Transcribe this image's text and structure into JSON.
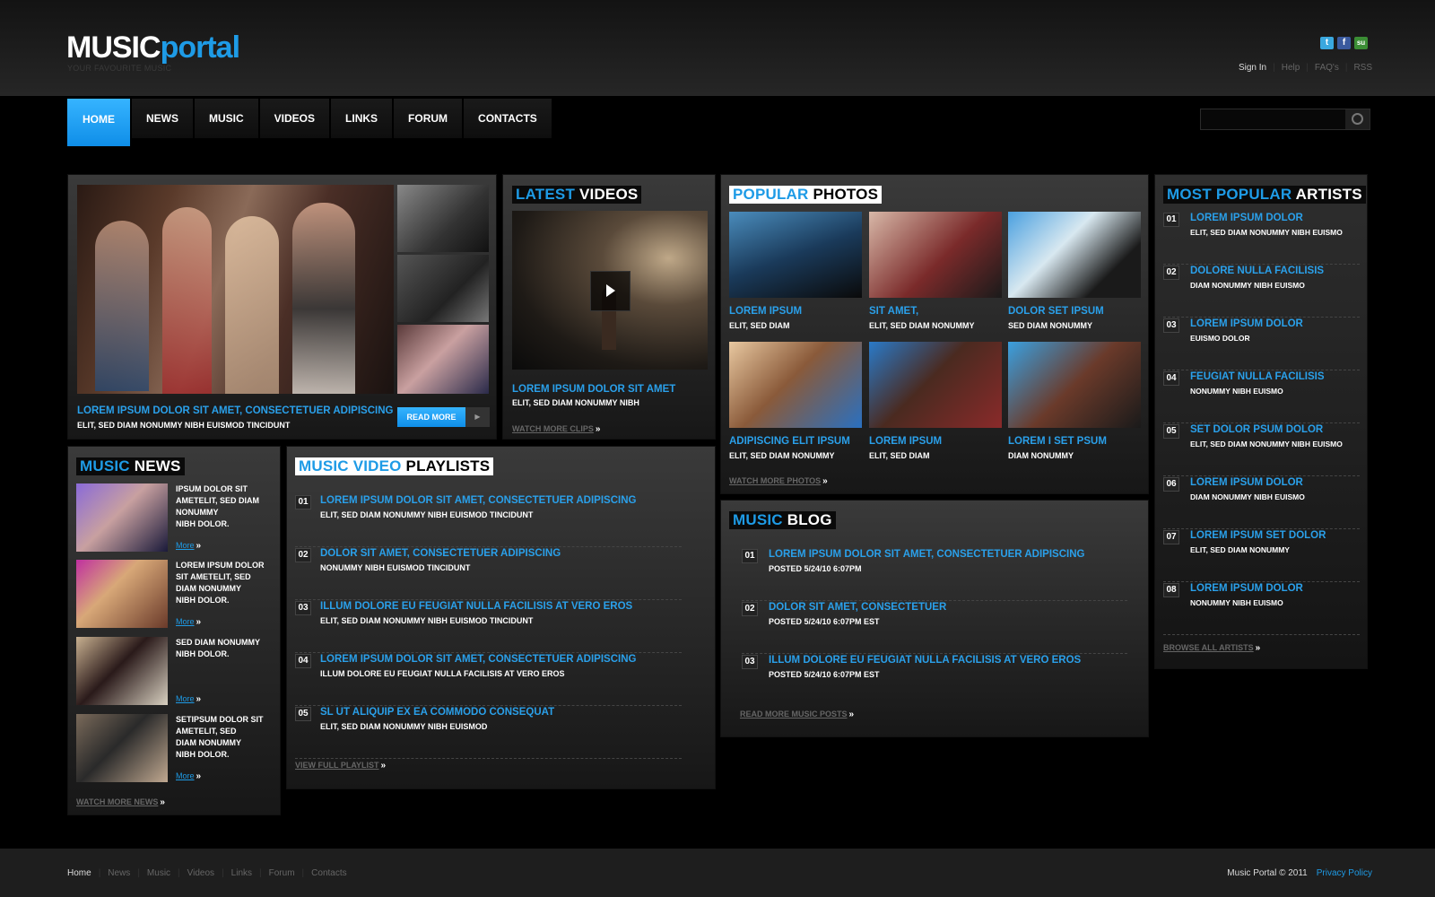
{
  "header": {
    "logo_part1": "MUSIC",
    "logo_part2": "portal",
    "tagline": "YOUR FAVOURITE MUSIC",
    "top_links": [
      "Sign In",
      "Help",
      "FAQ's",
      "RSS"
    ]
  },
  "nav": {
    "items": [
      "HOME",
      "NEWS",
      "MUSIC",
      "VIDEOS",
      "LINKS",
      "FORUM",
      "CONTACTS"
    ],
    "active": "HOME"
  },
  "search": {
    "value": ""
  },
  "featured": {
    "title": "LOREM IPSUM DOLOR SIT AMET, CONSECTETUER ADIPISCING",
    "subtitle": "ELIT, SED DIAM NONUMMY NIBH EUISMOD TINCIDUNT",
    "read_more": "READ MORE"
  },
  "latest_videos": {
    "heading_a": "LATEST",
    "heading_b": "VIDEOS",
    "title": "LOREM IPSUM DOLOR SIT AMET",
    "subtitle": "ELIT, SED DIAM NONUMMY NIBH",
    "more": "WATCH MORE CLIPS"
  },
  "popular_photos": {
    "heading_a": "POPULAR",
    "heading_b": "PHOTOS",
    "items": [
      {
        "title": "LOREM IPSUM",
        "sub": "ELIT, SED DIAM"
      },
      {
        "title": "SIT AMET,",
        "sub": "ELIT, SED DIAM NONUMMY"
      },
      {
        "title": "DOLOR SET IPSUM",
        "sub": "SED DIAM NONUMMY"
      },
      {
        "title": "ADIPISCING ELIT IPSUM",
        "sub": "ELIT, SED DIAM NONUMMY"
      },
      {
        "title": "LOREM IPSUM",
        "sub": "ELIT, SED DIAM"
      },
      {
        "title": "LOREM I SET PSUM",
        "sub": "DIAM NONUMMY"
      }
    ],
    "more": "WATCH MORE PHOTOS"
  },
  "artists": {
    "heading_a": "MOST POPULAR",
    "heading_b": "ARTISTS",
    "items": [
      {
        "num": "01",
        "title": "LOREM IPSUM DOLOR",
        "sub": "ELIT, SED DIAM NONUMMY NIBH EUISMO"
      },
      {
        "num": "02",
        "title": "DOLORE NULLA FACILISIS",
        "sub": " DIAM NONUMMY NIBH EUISMO"
      },
      {
        "num": "03",
        "title": "LOREM IPSUM DOLOR",
        "sub": "EUISMO DOLOR"
      },
      {
        "num": "04",
        "title": "FEUGIAT NULLA FACILISIS",
        "sub": "NONUMMY NIBH EUISMO"
      },
      {
        "num": "05",
        "title": "SET DOLOR PSUM DOLOR",
        "sub": "ELIT, SED DIAM NONUMMY NIBH EUISMO"
      },
      {
        "num": "06",
        "title": "LOREM IPSUM DOLOR",
        "sub": " DIAM NONUMMY NIBH EUISMO"
      },
      {
        "num": "07",
        "title": "LOREM IPSUM SET  DOLOR",
        "sub": "ELIT, SED DIAM NONUMMY"
      },
      {
        "num": "08",
        "title": "LOREM IPSUM DOLOR",
        "sub": "NONUMMY NIBH EUISMO"
      }
    ],
    "more": "BROWSE ALL ARTISTS"
  },
  "music_news": {
    "heading_a": "MUSIC",
    "heading_b": "NEWS",
    "items": [
      {
        "lines": [
          "IPSUM DOLOR SIT",
          "AMETELIT, SED DIAM",
          "NONUMMY",
          "NIBH DOLOR."
        ],
        "more": "More"
      },
      {
        "lines": [
          "LOREM IPSUM DOLOR",
          "SIT AMETELIT, SED",
          "DIAM NONUMMY",
          "NIBH DOLOR."
        ],
        "more": "More"
      },
      {
        "lines": [
          " SED DIAM NONUMMY",
          "NIBH DOLOR."
        ],
        "more": "More"
      },
      {
        "lines": [
          "SETIPSUM DOLOR SIT",
          "AMETELIT, SED",
          " DIAM NONUMMY",
          "NIBH DOLOR."
        ],
        "more": "More"
      }
    ],
    "more": "WATCH MORE NEWS"
  },
  "playlists": {
    "heading_a": "MUSIC VIDEO",
    "heading_b": "PLAYLISTS",
    "items": [
      {
        "num": "01",
        "title": "LOREM IPSUM DOLOR SIT AMET, CONSECTETUER ADIPISCING",
        "sub": "ELIT, SED DIAM NONUMMY NIBH EUISMOD TINCIDUNT"
      },
      {
        "num": "02",
        "title": " DOLOR SIT AMET, CONSECTETUER ADIPISCING",
        "sub": " NONUMMY NIBH EUISMOD TINCIDUNT"
      },
      {
        "num": "03",
        "title": "ILLUM DOLORE EU FEUGIAT NULLA FACILISIS AT VERO EROS",
        "sub": "ELIT, SED DIAM NONUMMY NIBH EUISMOD TINCIDUNT"
      },
      {
        "num": "04",
        "title": "LOREM IPSUM DOLOR SIT AMET, CONSECTETUER ADIPISCING",
        "sub": "ILLUM DOLORE EU FEUGIAT NULLA FACILISIS AT VERO EROS"
      },
      {
        "num": "05",
        "title": "SL UT ALIQUIP EX EA COMMODO CONSEQUAT",
        "sub": "ELIT, SED DIAM NONUMMY NIBH EUISMOD"
      }
    ],
    "more": "VIEW FULL PLAYLIST"
  },
  "blog": {
    "heading_a": "MUSIC",
    "heading_b": "BLOG",
    "items": [
      {
        "num": "01",
        "title": "LOREM IPSUM DOLOR SIT AMET, CONSECTETUER ADIPISCING",
        "sub": "POSTED 5/24/10 6:07PM"
      },
      {
        "num": "02",
        "title": "DOLOR SIT AMET, CONSECTETUER",
        "sub": "POSTED 5/24/10 6:07PM EST"
      },
      {
        "num": "03",
        "title": "ILLUM DOLORE EU FEUGIAT NULLA FACILISIS AT VERO EROS",
        "sub": "POSTED 5/24/10 6:07PM EST"
      }
    ],
    "more": "READ MORE MUSIC POSTS"
  },
  "footer": {
    "links": [
      "Home",
      "News",
      "Music",
      "Videos",
      "Links",
      "Forum",
      "Contacts"
    ],
    "copyright": "Music Portal © 2011",
    "privacy": "Privacy Policy"
  },
  "colors": {
    "accent": "#1e9be6",
    "nav_active": "#1a9ef0",
    "background": "#000000"
  },
  "icons": [
    "twitter-icon",
    "facebook-icon",
    "stumbleupon-icon",
    "search-icon",
    "play-icon"
  ]
}
